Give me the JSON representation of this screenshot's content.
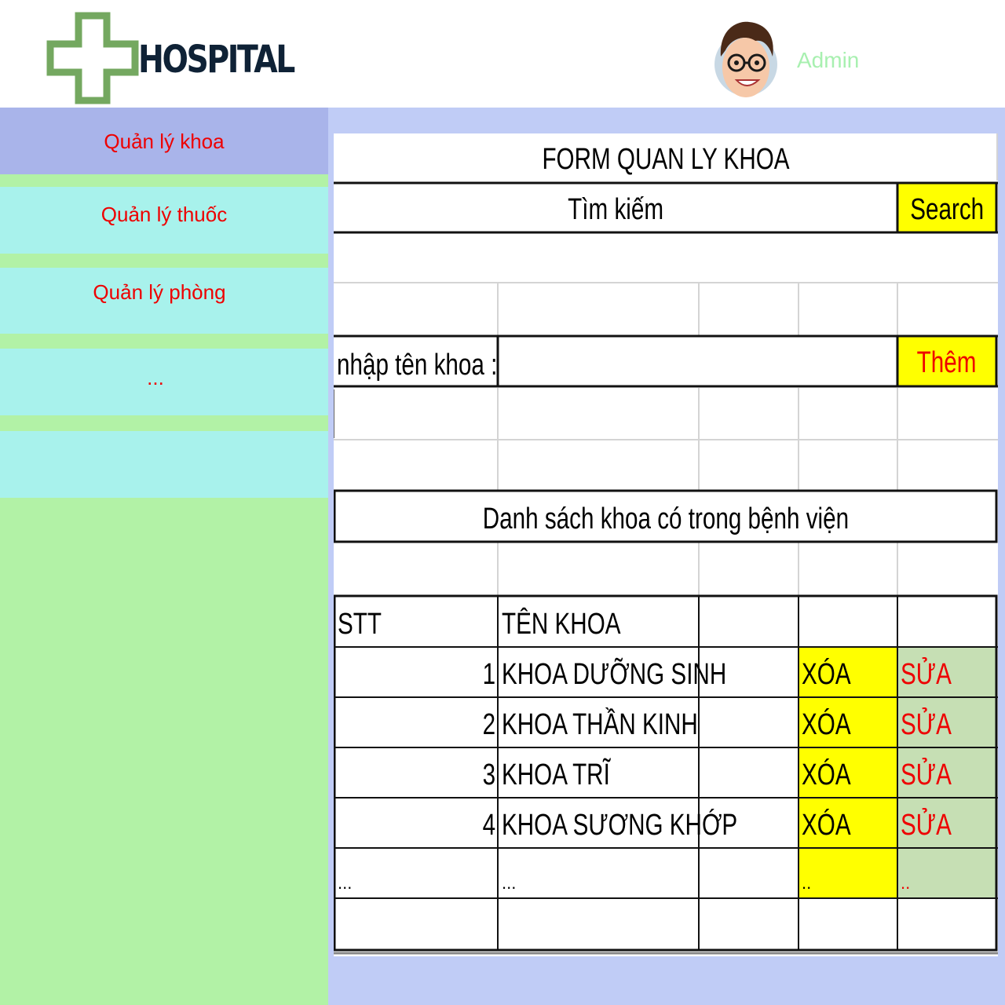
{
  "header": {
    "logo_text": "HOSPITAL",
    "user_name": "Admin"
  },
  "sidebar": {
    "items": [
      {
        "label": "Quản lý khoa",
        "active": true
      },
      {
        "label": "Quản lý thuốc",
        "active": false
      },
      {
        "label": "Quản lý phòng",
        "active": false
      },
      {
        "label": "...",
        "active": false
      },
      {
        "label": "",
        "active": false
      }
    ]
  },
  "form": {
    "title": "FORM QUAN LY KHOA",
    "search_input_value": "Tìm kiếm",
    "search_button": "Search",
    "name_label": "nhập tên khoa :",
    "name_input_value": "",
    "add_button": "Thêm",
    "list_title": "Danh sách khoa có trong bệnh viện"
  },
  "table": {
    "headers": {
      "stt": "STT",
      "name": "TÊN KHOA"
    },
    "rows": [
      {
        "stt": "1",
        "name": "KHOA DƯỠNG SINH",
        "delete": "XÓA",
        "edit": "SỬA"
      },
      {
        "stt": "2",
        "name": "KHOA THẦN KINH",
        "delete": "XÓA",
        "edit": "SỬA"
      },
      {
        "stt": "3",
        "name": "KHOA TRĨ",
        "delete": "XÓA",
        "edit": "SỬA"
      },
      {
        "stt": "4",
        "name": "KHOA SƯƠNG KHỚP",
        "delete": "XÓA",
        "edit": "SỬA"
      }
    ],
    "more_row": {
      "stt": "...",
      "name": "...",
      "delete": "..",
      "edit": ".."
    }
  },
  "colors": {
    "sidebar_bg": "#b2f2a6",
    "nav_active_bg": "#a9b4ea",
    "nav_item_bg": "#a8f2ec",
    "nav_text": "#ee0000",
    "content_bg": "#c0ccf6",
    "button_yellow": "#ffff00",
    "edit_bg": "#c6dfb4",
    "red_text": "#ee0000"
  },
  "icons": {
    "logo": "medical-cross-icon",
    "avatar": "user-avatar-icon"
  }
}
